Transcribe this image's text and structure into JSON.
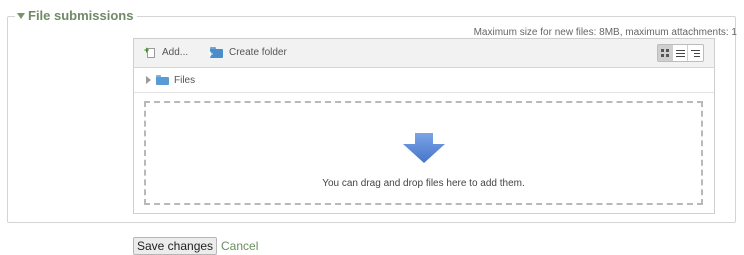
{
  "fieldset": {
    "legend": "File submissions"
  },
  "filepicker": {
    "max_info": "Maximum size for new files: 8MB, maximum attachments: 1",
    "toolbar": {
      "add_label": "Add...",
      "create_folder_label": "Create folder",
      "view_icons": [
        "icon-view-icon",
        "list-view-icon",
        "tree-view-icon"
      ],
      "active_view": "icon-view"
    },
    "path": {
      "folder_label": "Files"
    },
    "dropzone": {
      "text": "You can drag and drop files here to add them."
    },
    "colors": {
      "legend": "#6f8a65",
      "arrow": "#5b8ad6",
      "link": "#6a8e5d"
    }
  },
  "actions": {
    "save_label": "Save changes",
    "cancel_label": "Cancel"
  }
}
